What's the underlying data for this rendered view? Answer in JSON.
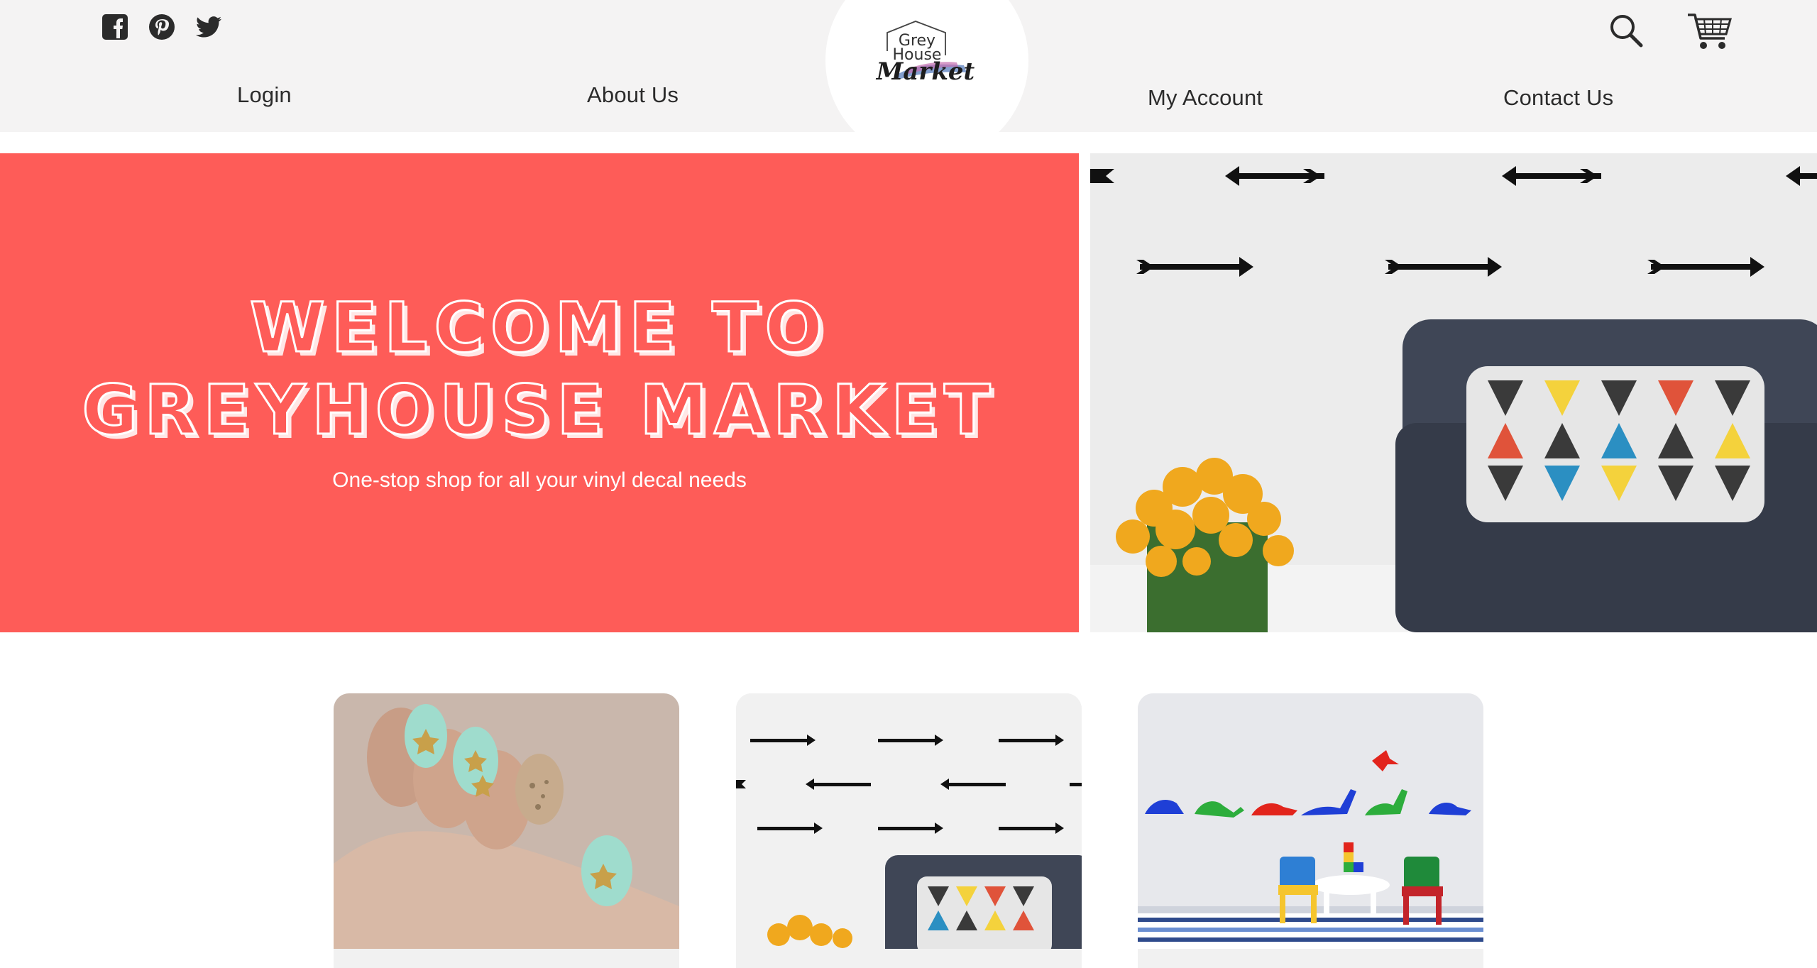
{
  "header": {
    "social": [
      {
        "name": "facebook-icon"
      },
      {
        "name": "pinterest-icon"
      },
      {
        "name": "twitter-icon"
      }
    ],
    "nav": {
      "login": "Login",
      "about": "About Us",
      "account": "My Account",
      "contact": "Contact Us"
    },
    "logo": {
      "line1": "Grey",
      "line2": "House",
      "line3": "Market"
    },
    "icons": {
      "search": "search-icon",
      "cart": "cart-icon"
    }
  },
  "hero": {
    "title_line1": "WELCOME TO",
    "title_line2": "GREYHOUSE MARKET",
    "subtitle": "One-stop shop for all your vinyl decal needs",
    "colors": {
      "accent": "#fe5c58"
    }
  },
  "products": [
    {
      "name": "nail-decals-card"
    },
    {
      "name": "arrow-wall-decals-card"
    },
    {
      "name": "dinosaur-wall-decals-card"
    }
  ]
}
